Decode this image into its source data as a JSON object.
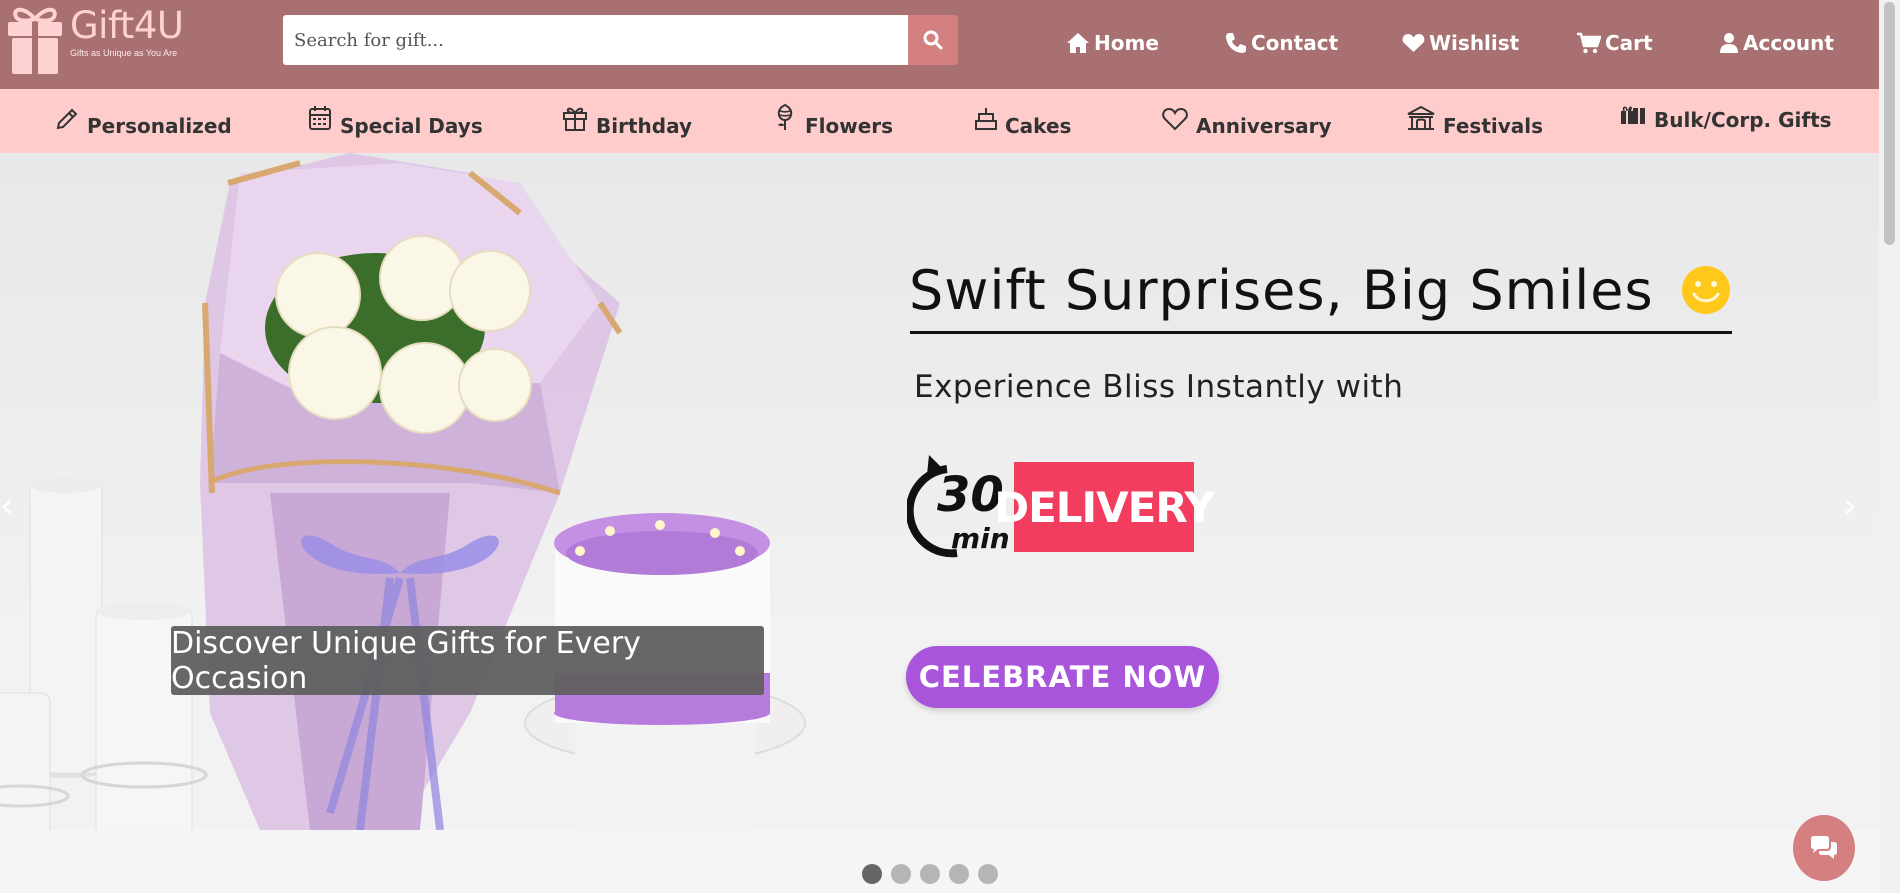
{
  "brand": {
    "name": "Gift4U",
    "tagline": "Gifts as Unique as You Are",
    "color": "#a87070"
  },
  "search": {
    "placeholder": "Search for gift...",
    "value": "",
    "icon": "search-icon"
  },
  "main_nav": [
    {
      "label": "Home",
      "icon": "home-icon"
    },
    {
      "label": "Contact",
      "icon": "phone-icon"
    },
    {
      "label": "Wishlist",
      "icon": "heart-icon"
    },
    {
      "label": "Cart",
      "icon": "cart-icon"
    },
    {
      "label": "Account",
      "icon": "user-icon"
    }
  ],
  "categories": [
    {
      "label": "Personalized",
      "icon": "pencil-icon"
    },
    {
      "label": "Special Days",
      "icon": "calendar-icon"
    },
    {
      "label": "Birthday",
      "icon": "gift-icon"
    },
    {
      "label": "Flowers",
      "icon": "flower-icon"
    },
    {
      "label": "Cakes",
      "icon": "cake-icon"
    },
    {
      "label": "Anniversary",
      "icon": "heart-outline-icon"
    },
    {
      "label": "Festivals",
      "icon": "temple-icon"
    },
    {
      "label": "Bulk/Corp. Gifts",
      "icon": "gifts-icon"
    }
  ],
  "hero": {
    "headline": "Swift Surprises, Big Smiles",
    "subline": "Experience Bliss Instantly with",
    "delivery_minutes": "30",
    "delivery_unit": "min",
    "delivery_label": "DELIVERY",
    "cta": "CELEBRATE NOW",
    "caption": "Discover Unique Gifts for Every Occasion",
    "prev": "‹",
    "next": "›"
  },
  "carousel": {
    "slides": 5,
    "active": 1
  },
  "colors": {
    "header": "#a87070",
    "category_bar": "#ffcccc",
    "accent": "#d48080",
    "cta": "#a855db",
    "delivery": "#f23d5e"
  }
}
